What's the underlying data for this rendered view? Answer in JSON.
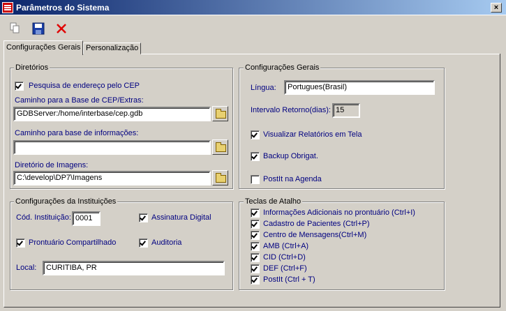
{
  "window": {
    "title": "Parâmetros do Sistema",
    "close_glyph": "×"
  },
  "toolbar": {
    "copy_icon": "copy-icon",
    "save_icon": "save-icon",
    "delete_icon": "delete-icon"
  },
  "tabs": [
    {
      "label": "Configurações Gerais"
    },
    {
      "label": "Personalização"
    }
  ],
  "diretorios": {
    "legend": "Diretórios",
    "cep_search_label": "Pesquisa de endereço pelo CEP",
    "cep_path_label": "Caminho para a Base de CEP/Extras:",
    "cep_path_value": "GDBServer:/home/interbase/cep.gdb",
    "info_path_label": "Caminho para base de informações:",
    "info_path_value": "",
    "images_dir_label": "Diretório de Imagens:",
    "images_dir_value": "C:\\develop\\DP7\\Imagens"
  },
  "config_gerais": {
    "legend": "Configurações Gerais",
    "lingua_label": "Língua:",
    "lingua_value": "Portugues(Brasil)",
    "intervalo_label": "Intervalo Retorno(dias):",
    "intervalo_value": "15",
    "visualizar_label": "Visualizar Relatórios em Tela",
    "backup_label": "Backup Obrigat.",
    "postit_label": "PostIt na Agenda"
  },
  "instituicoes": {
    "legend": "Configurações da Instituições",
    "cod_label": "Cód. Instituição:",
    "cod_value": "0001",
    "assinatura_label": "Assinatura Digital",
    "prontuario_label": "Prontuário Compartilhado",
    "auditoria_label": "Auditoria",
    "local_label": "Local:",
    "local_value": "CURITIBA, PR"
  },
  "teclas": {
    "legend": "Teclas de Atalho",
    "items": [
      {
        "label": "Informações Adicionais no prontuário (Ctrl+I)"
      },
      {
        "label": "Cadastro de Pacientes (Ctrl+P)"
      },
      {
        "label": "Centro de Mensagens(Ctrl+M)"
      },
      {
        "label": "AMB (Ctrl+A)"
      },
      {
        "label": "CID (Ctrl+D)"
      },
      {
        "label": "DEF (Ctrl+F)"
      },
      {
        "label": "PostIt (Ctrl + T)"
      }
    ]
  }
}
